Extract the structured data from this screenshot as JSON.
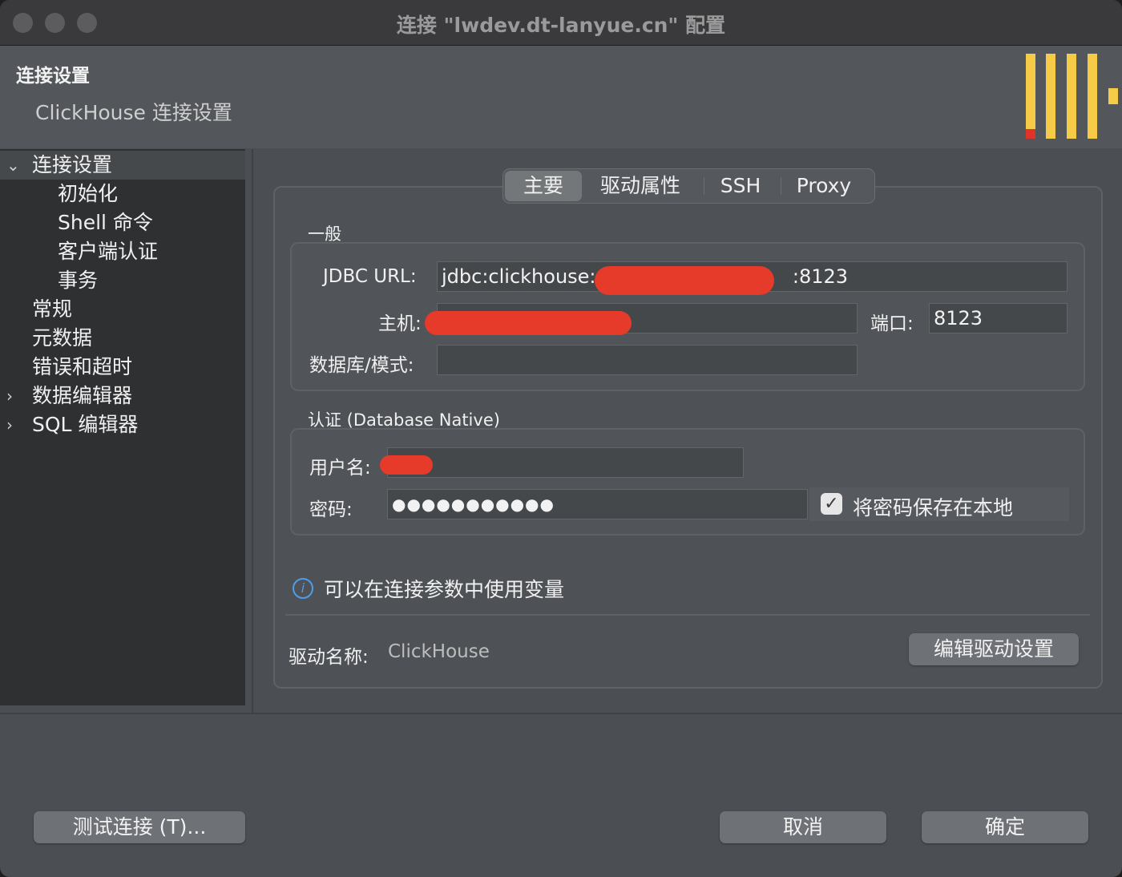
{
  "window": {
    "title": "连接 \"lwdev.dt-lanyue.cn\" 配置"
  },
  "header": {
    "title": "连接设置",
    "subtitle": "ClickHouse 连接设置"
  },
  "sidebar": {
    "items": [
      {
        "label": "连接设置",
        "arrow": "⌄"
      },
      {
        "label": "初始化"
      },
      {
        "label": "Shell 命令"
      },
      {
        "label": "客户端认证"
      },
      {
        "label": "事务"
      },
      {
        "label": "常规"
      },
      {
        "label": "元数据"
      },
      {
        "label": "错误和超时"
      },
      {
        "label": "数据编辑器",
        "arrow": "›"
      },
      {
        "label": "SQL 编辑器",
        "arrow": "›"
      }
    ]
  },
  "tabs": [
    "主要",
    "驱动属性",
    "SSH",
    "Proxy"
  ],
  "general": {
    "label": "一般",
    "jdbc_label": "JDBC URL:",
    "jdbc_prefix": "jdbc:clickhouse:/",
    "jdbc_suffix": ":8123",
    "host_label": "主机:",
    "port_label": "端口:",
    "port_value": "8123",
    "db_label": "数据库/模式:",
    "db_value": ""
  },
  "auth": {
    "label": "认证 (Database Native)",
    "user_label": "用户名:",
    "password_label": "密码:",
    "password_value": "●●●●●●●●●●●",
    "save_password_label": "将密码保存在本地",
    "save_password_checked": true
  },
  "info": {
    "text": "可以在连接参数中使用变量",
    "icon": "i"
  },
  "driver": {
    "label": "驱动名称:",
    "value": "ClickHouse",
    "edit_button": "编辑驱动设置"
  },
  "footer": {
    "test_button": "测试连接 (T)...",
    "cancel_button": "取消",
    "ok_button": "确定"
  },
  "colors": {
    "logo_yellow": "#f5cb47",
    "logo_red": "#e0342a",
    "redaction": "#e63a2b",
    "info": "#4f9de8"
  }
}
